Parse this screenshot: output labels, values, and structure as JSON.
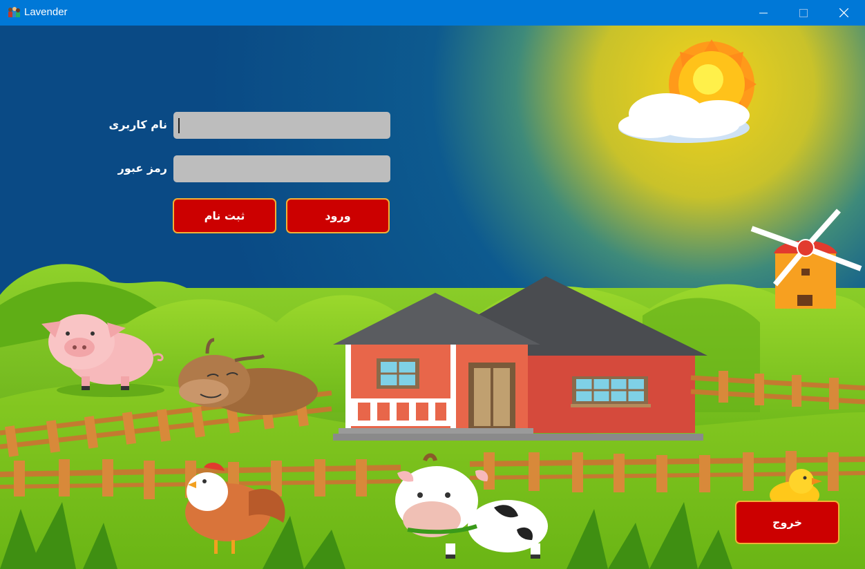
{
  "window": {
    "title": "Lavender",
    "app_icon": "app-icon",
    "controls": [
      "minimize-icon",
      "maximize-icon",
      "close-icon"
    ]
  },
  "login": {
    "username_label": "نام کاربری",
    "username_value": "",
    "password_label": "رمز عبور",
    "password_value": "",
    "login_button": "ورود",
    "register_button": "ثبت نام",
    "exit_button": "خروج"
  },
  "colors": {
    "titlebar": "#0078d7",
    "button_red": "#cc0000",
    "button_border": "#f2b134",
    "field_bg": "#bdbdbd",
    "sky": "#0a4f8a",
    "grass": "#7cc520"
  }
}
